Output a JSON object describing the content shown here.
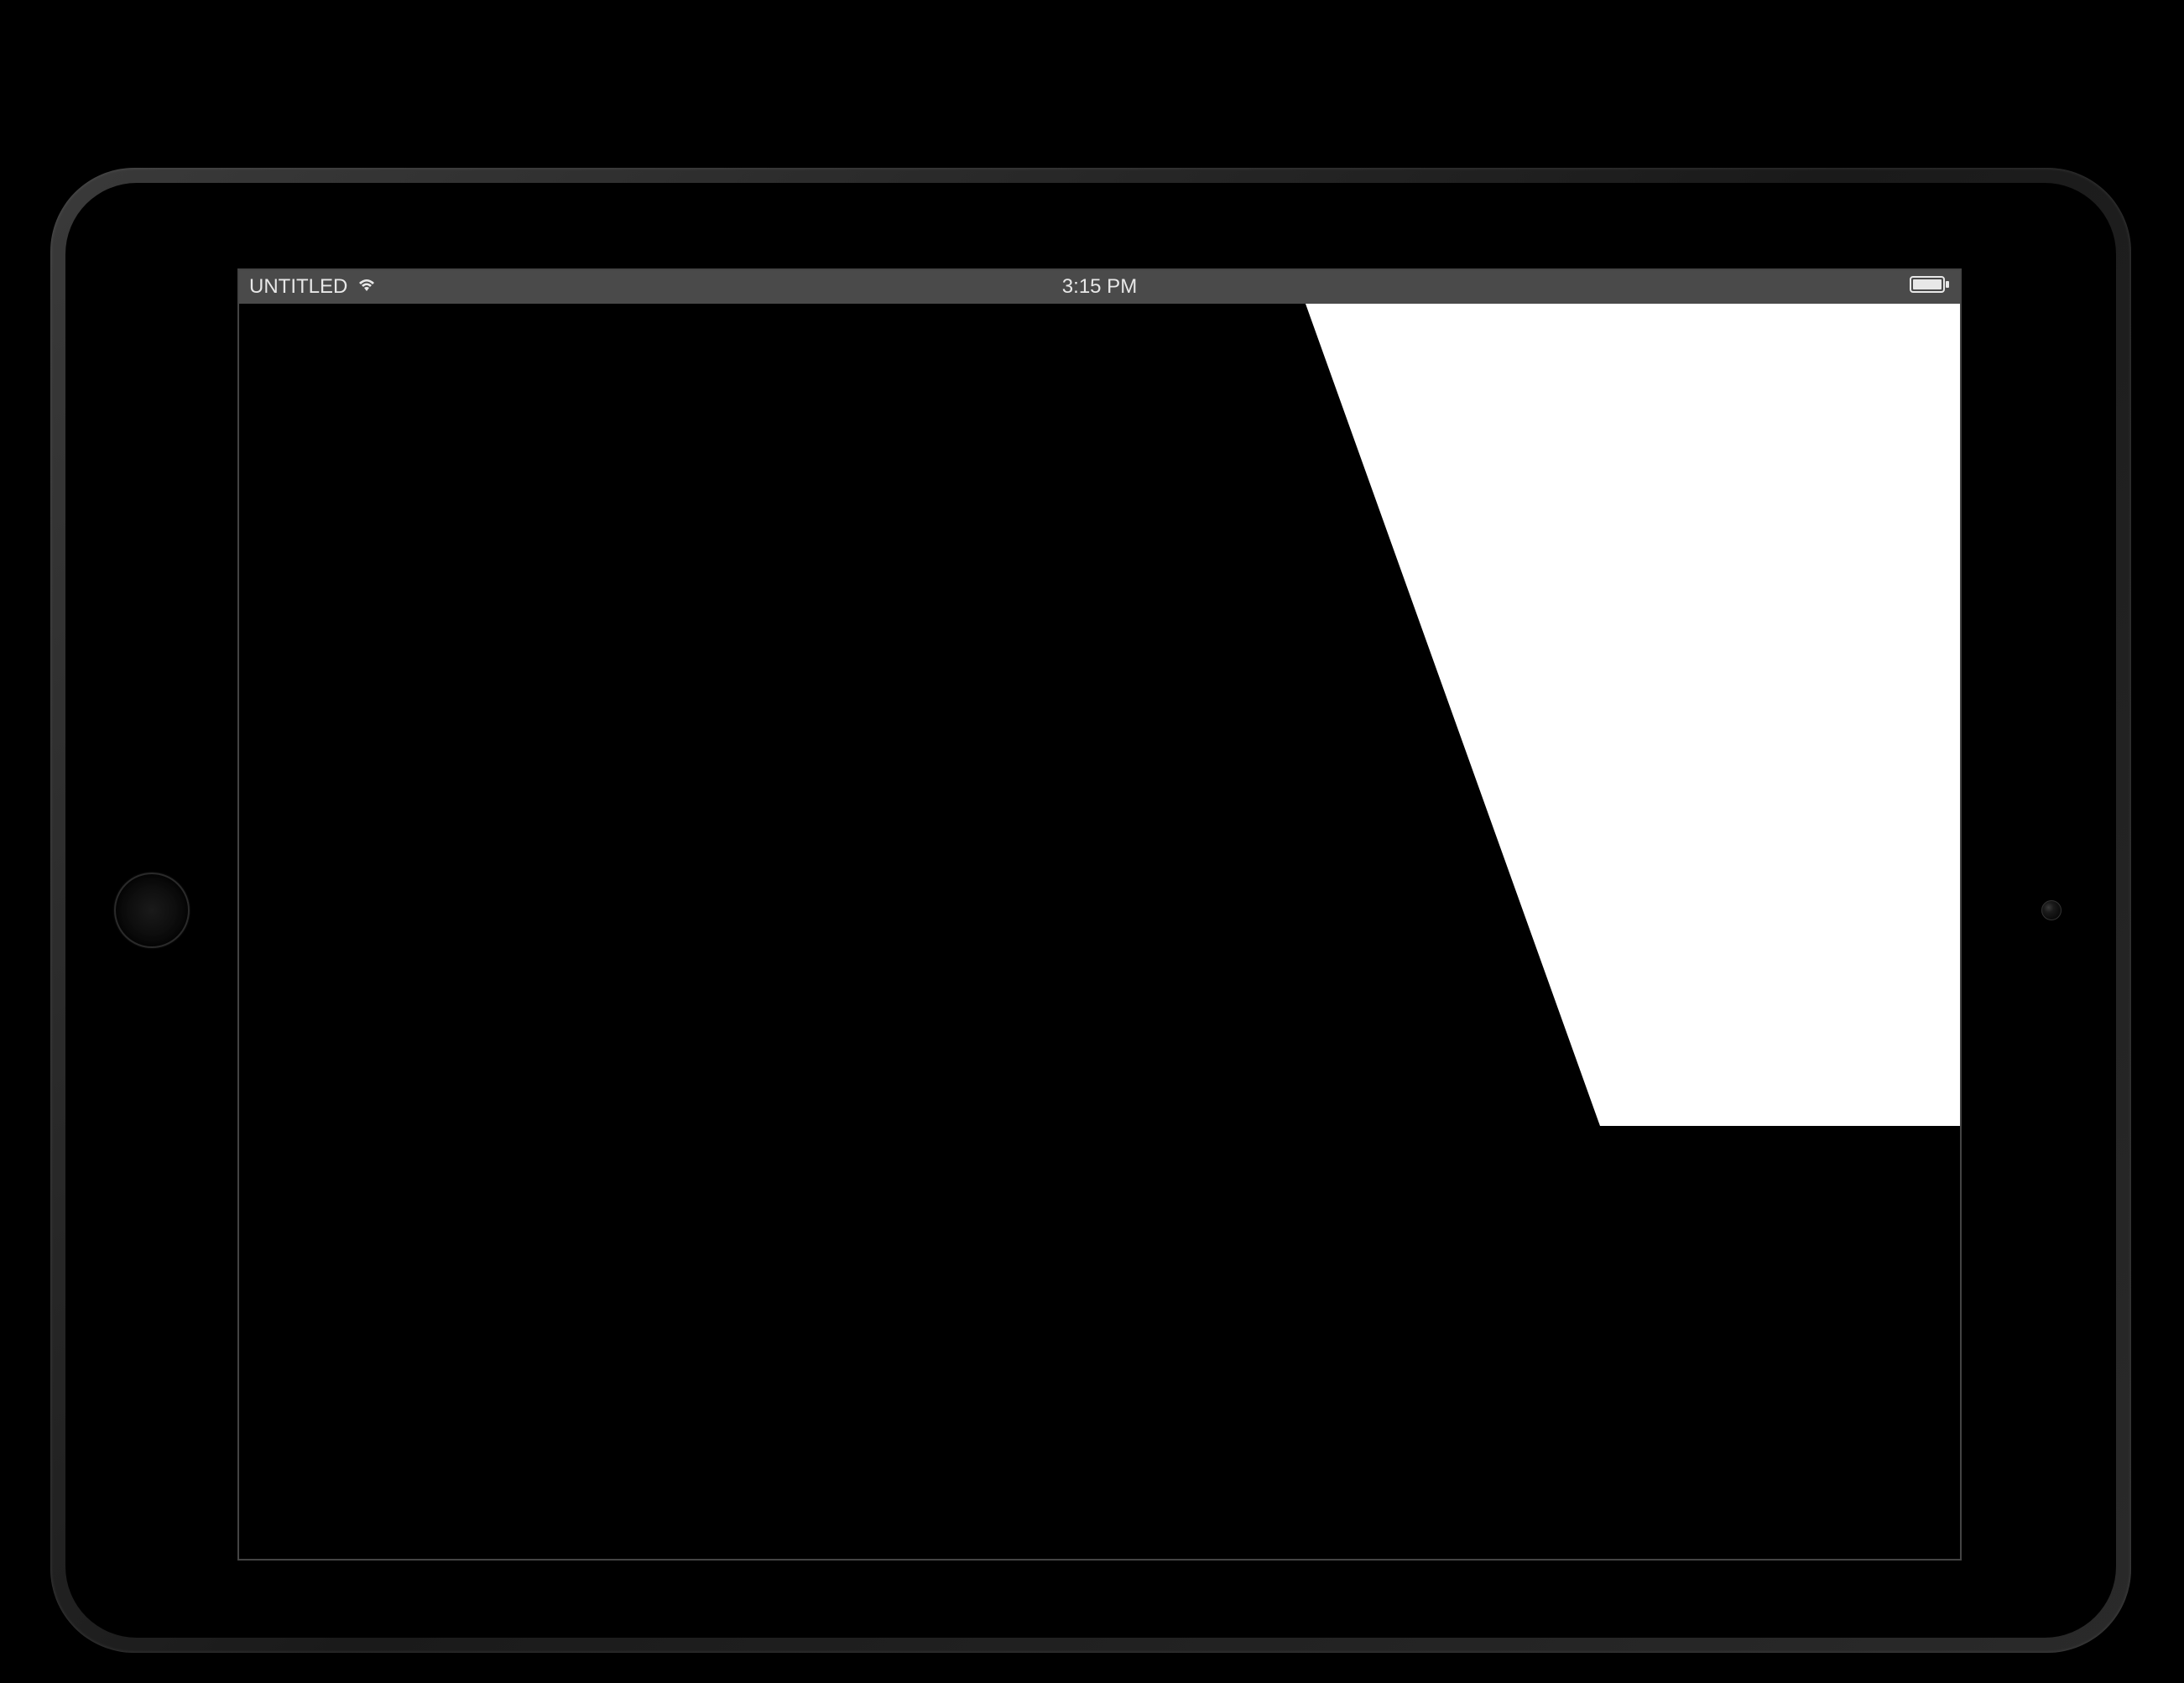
{
  "status_bar": {
    "carrier_label": "UNTITLED",
    "wifi_icon": "wifi-icon",
    "time": "3:15 PM",
    "battery_icon": "battery-icon"
  }
}
